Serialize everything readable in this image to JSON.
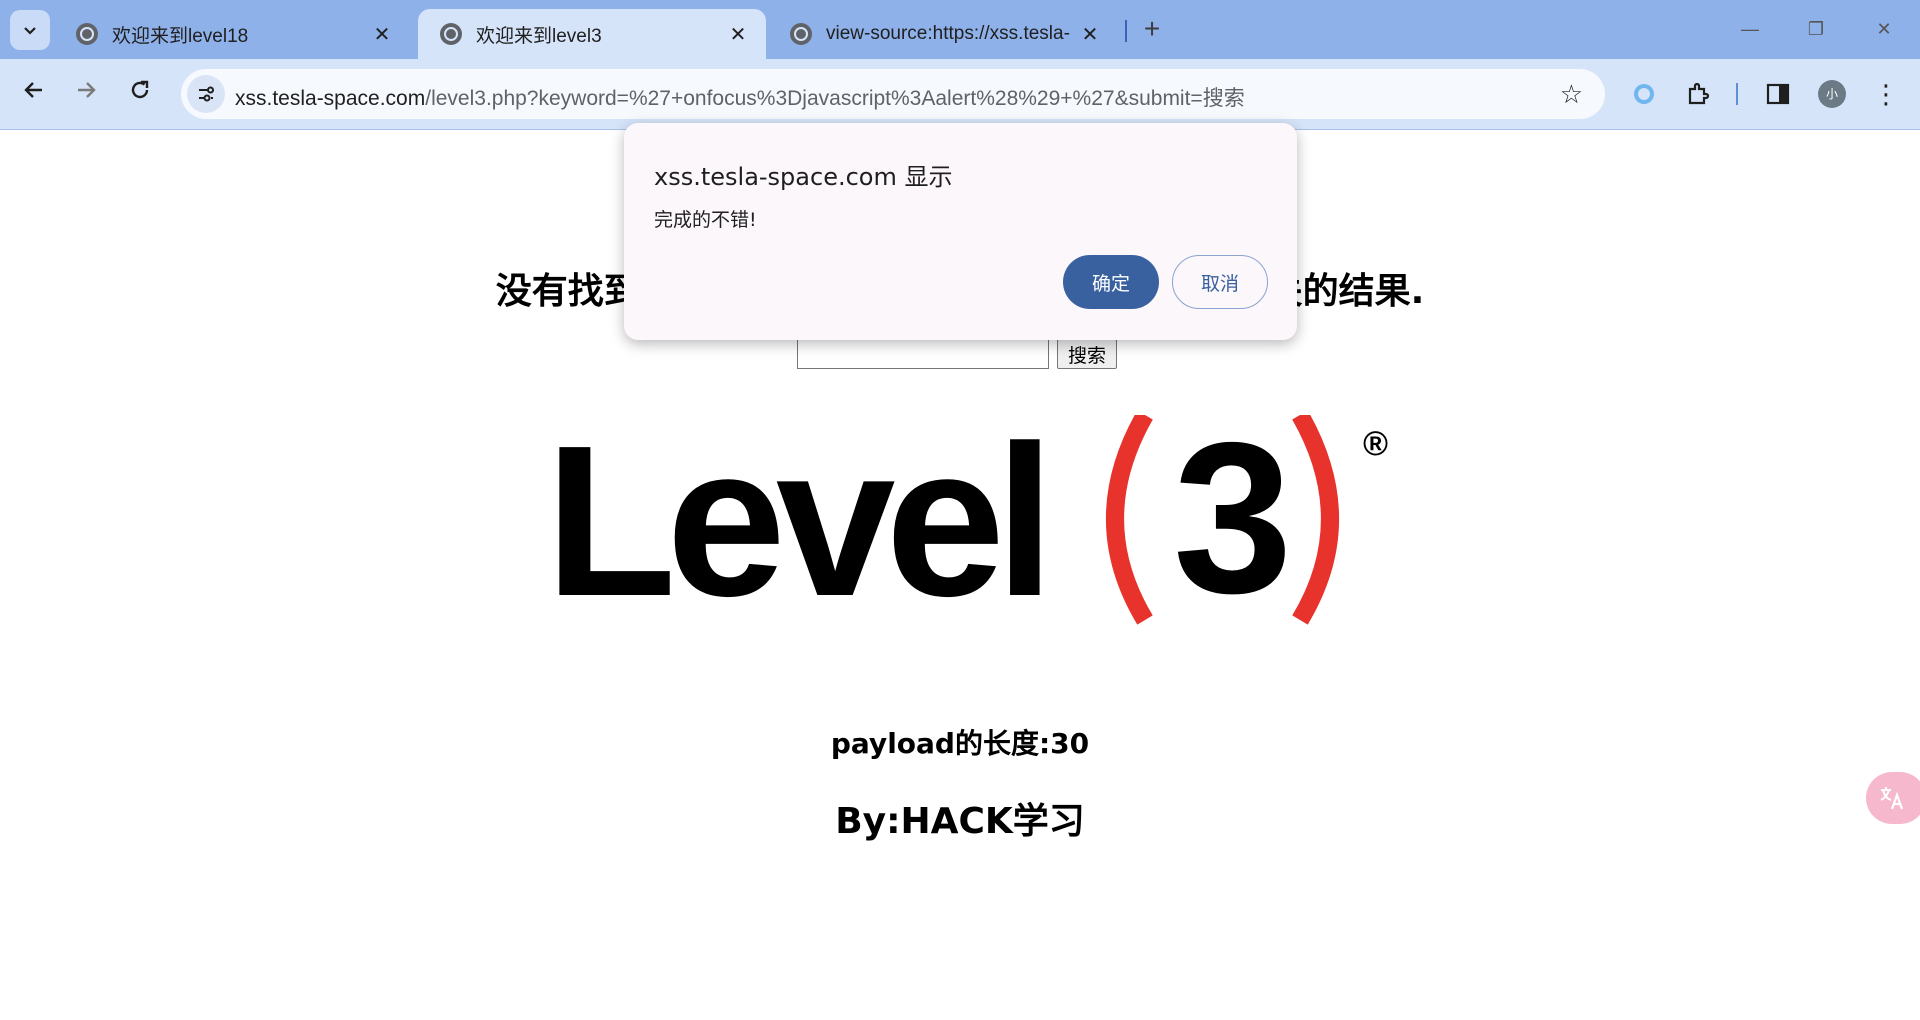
{
  "browser": {
    "tabs": [
      {
        "title": "欢迎来到level18",
        "active": false
      },
      {
        "title": "欢迎来到level3",
        "active": true
      },
      {
        "title": "view-source:https://xss.tesla-",
        "active": false
      }
    ],
    "url_host": "xss.tesla-space.com",
    "url_path": "/level3.php?keyword=%27+onfocus%3Djavascript%3Aalert%28%29+%27&submit=搜索",
    "avatar_label": "小"
  },
  "page": {
    "heading": "没有找到和'onfocus=javascript:alert()'相关的结果.",
    "search_button": "搜索",
    "search_value": "",
    "logo_text": "Level",
    "logo_number": "3",
    "logo_mark": "®",
    "payload_length": "payload的长度:30",
    "author": "By:HACK学习"
  },
  "dialog": {
    "title": "xss.tesla-space.com 显示",
    "message": "完成的不错!",
    "ok_label": "确定",
    "cancel_label": "取消"
  },
  "colors": {
    "tabstrip": "#8fb1e9",
    "toolbar": "#d6e4fa",
    "logo_paren": "#e8322c",
    "dialog_ok": "#39619f"
  }
}
